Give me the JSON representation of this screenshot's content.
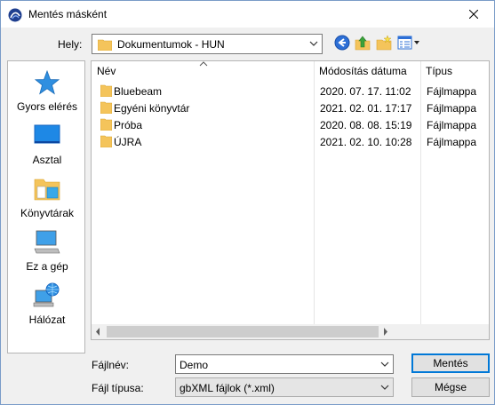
{
  "window": {
    "title": "Mentés másként",
    "close_icon": "close-icon"
  },
  "location": {
    "label": "Hely:",
    "value": "Dokumentumok - HUN"
  },
  "toolbar": {
    "icons": [
      "back-icon",
      "up-folder-icon",
      "new-folder-icon",
      "view-menu-icon"
    ]
  },
  "places": [
    {
      "label": "Gyors elérés",
      "icon": "star-icon"
    },
    {
      "label": "Asztal",
      "icon": "desktop-icon"
    },
    {
      "label": "Könyvtárak",
      "icon": "libraries-icon"
    },
    {
      "label": "Ez a gép",
      "icon": "computer-icon"
    },
    {
      "label": "Hálózat",
      "icon": "network-icon"
    }
  ],
  "files": {
    "columns": [
      "Név",
      "Módosítás dátuma",
      "Típus"
    ],
    "rows": [
      {
        "name": "Bluebeam",
        "date": "2020. 07. 17. 11:02",
        "type": "Fájlmappa"
      },
      {
        "name": "Egyéni könyvtár",
        "date": "2021. 02. 01. 17:17",
        "type": "Fájlmappa"
      },
      {
        "name": "Próba",
        "date": "2020. 08. 08. 15:19",
        "type": "Fájlmappa"
      },
      {
        "name": "ÚJRA",
        "date": "2021. 02. 10. 10:28",
        "type": "Fájlmappa"
      }
    ]
  },
  "form": {
    "filename_label": "Fájlnév:",
    "filename_value": "Demo",
    "filetype_label": "Fájl típusa:",
    "filetype_value": "gbXML fájlok (*.xml)"
  },
  "buttons": {
    "save": "Mentés",
    "cancel": "Mégse"
  },
  "colors": {
    "accent": "#0078d7",
    "folder": "#f4c45b"
  }
}
